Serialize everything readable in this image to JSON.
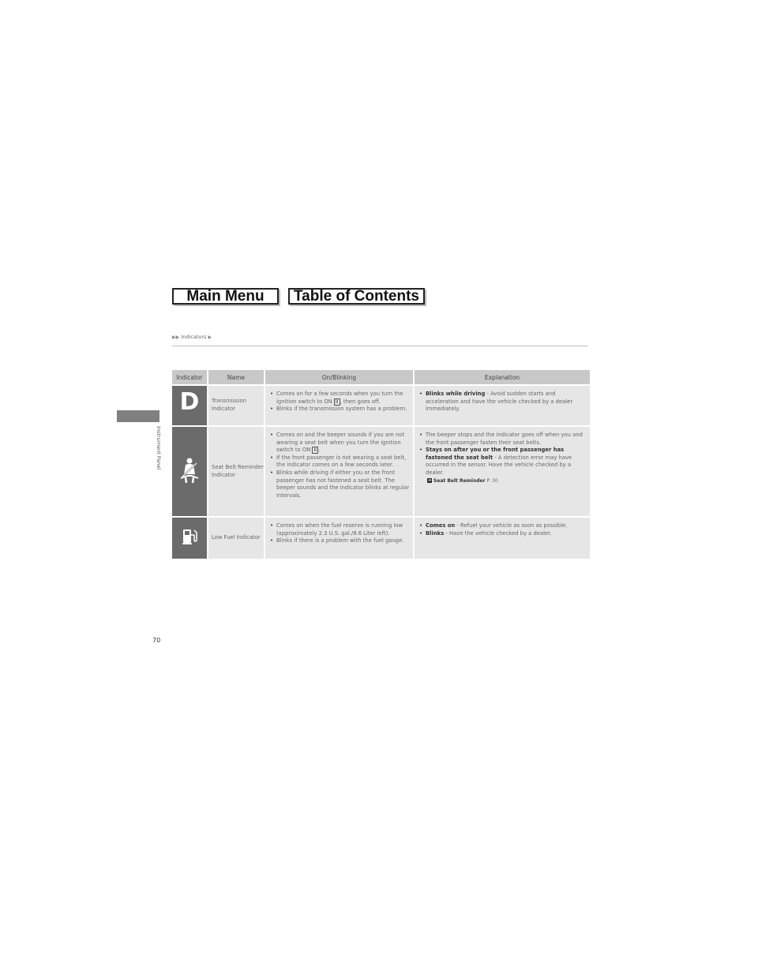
{
  "nav": {
    "main_menu": "Main Menu",
    "table_of_contents": "Table of Contents"
  },
  "breadcrumb": {
    "section": "Indicators"
  },
  "side_tab": {
    "label": "Instrument Panel"
  },
  "table": {
    "headers": [
      "Indicator",
      "Name",
      "On/Blinking",
      "Explanation"
    ],
    "rows": [
      {
        "icon": "transmission-d-icon",
        "icon_glyph": "D",
        "name": "Transmission Indicator",
        "on_blinking": [
          {
            "pre": "Comes on for a few seconds when you turn the ignition switch to ON ",
            "key": "II",
            "post": ", then goes off."
          },
          {
            "pre": "Blinks if the transmission system has a problem."
          }
        ],
        "explanation": [
          {
            "bold": "Blinks while driving",
            "text": " - Avoid sudden starts and acceleration and have the vehicle checked by a dealer immediately."
          }
        ]
      },
      {
        "icon": "seat-belt-icon",
        "name": "Seat Belt Reminder Indicator",
        "on_blinking": [
          {
            "pre": "Comes on and the beeper sounds if you are not wearing a seat belt when you turn the ignition switch to ON ",
            "key": "II",
            "post": "."
          },
          {
            "pre": "If the front passenger is not wearing a seat belt, the indicator comes on a few seconds later."
          },
          {
            "pre": "Blinks while driving if either you or the front passenger has not fastened a seat belt. The beeper sounds and the indicator blinks at regular intervals."
          }
        ],
        "explanation": [
          {
            "text": "The beeper stops and the indicator goes off when you and the front passenger fasten their seat belts."
          },
          {
            "bold": "Stays on after you or the front passenger has fastened the seat belt",
            "text": " - A detection error may have occurred in the sensor. Have the vehicle checked by a dealer."
          }
        ],
        "reference": {
          "title": "Seat Belt Reminder",
          "page": "P. 30"
        }
      },
      {
        "icon": "fuel-pump-icon",
        "name": "Low Fuel Indicator",
        "on_blinking": [
          {
            "pre": "Comes on when the fuel reserve is running low (approximately 2.3 U.S. gal./8.6 Liter left)."
          },
          {
            "pre": "Blinks if there is a problem with the fuel gauge."
          }
        ],
        "explanation": [
          {
            "bold": "Comes on",
            "text": " - Refuel your vehicle as soon as possible."
          },
          {
            "bold": "Blinks",
            "text": " - Have the vehicle checked by a dealer."
          }
        ]
      }
    ]
  },
  "page_number": "70"
}
